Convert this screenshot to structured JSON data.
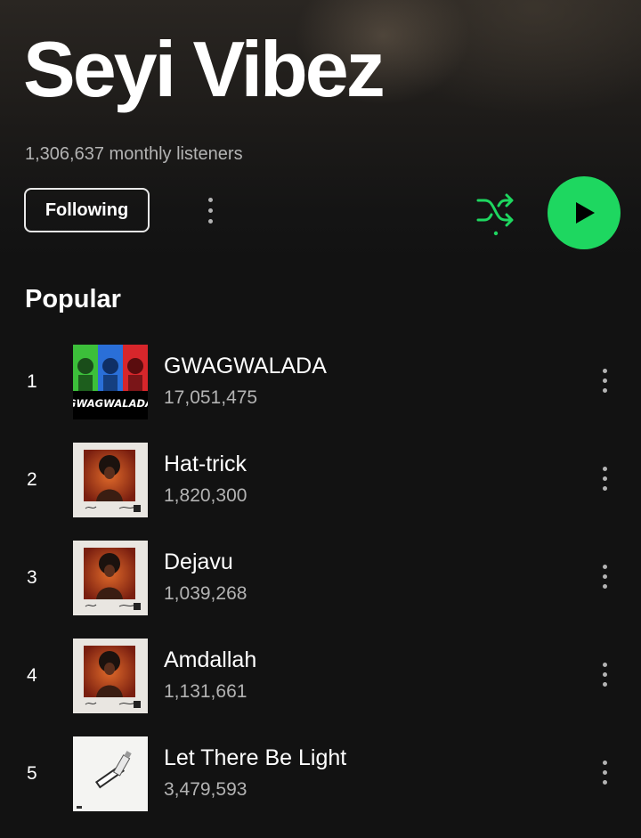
{
  "artist": {
    "name": "Seyi Vibez",
    "monthly_listeners": "1,306,637 monthly listeners"
  },
  "actions": {
    "follow_label": "Following",
    "more_icon": "more-vertical-icon",
    "shuffle_icon": "shuffle-icon",
    "play_icon": "play-icon"
  },
  "colors": {
    "accent": "#1ed760",
    "background": "#121212",
    "secondary_text": "#b3b3b3"
  },
  "popular": {
    "title": "Popular",
    "tracks": [
      {
        "num": "1",
        "title": "GWAGWALADA",
        "plays": "17,051,475",
        "art_text": "GWAGWALADA"
      },
      {
        "num": "2",
        "title": "Hat-trick",
        "plays": "1,820,300"
      },
      {
        "num": "3",
        "title": "Dejavu",
        "plays": "1,039,268"
      },
      {
        "num": "4",
        "title": "Amdallah",
        "plays": "1,131,661"
      },
      {
        "num": "5",
        "title": "Let There Be Light",
        "plays": "3,479,593"
      }
    ]
  }
}
